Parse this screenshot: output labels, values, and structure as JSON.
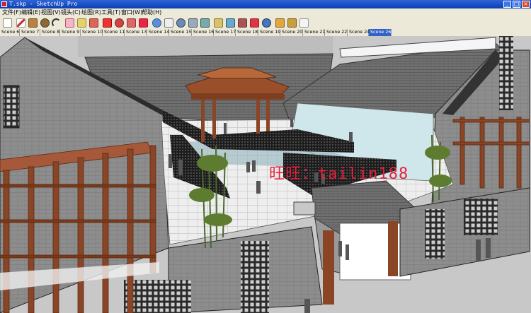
{
  "window": {
    "title": "T.skp - SketchUp Pro",
    "controls": [
      "minimize",
      "maximize",
      "close"
    ]
  },
  "menu": [
    "文件(F)",
    "编辑(E)",
    "视图(V)",
    "镜头(C)",
    "绘图(R)",
    "工具(T)",
    "窗口(W)",
    "帮助(H)"
  ],
  "toolbar": {
    "tools": [
      "select-icon",
      "pencil-icon",
      "rectangle-icon",
      "circle-icon",
      "arc-icon",
      "eraser-icon",
      "tape-measure-icon",
      "paint-bucket-icon",
      "push-pull-icon",
      "rotate-icon",
      "follow-me-icon",
      "offset-icon",
      "orbit-icon",
      "pan-icon",
      "zoom-icon",
      "zoom-window-icon",
      "zoom-extents-icon",
      "section-plane-icon",
      "walk-icon",
      "look-around-icon",
      "get-models-icon",
      "share-model-icon",
      "components-icon",
      "styles-icon"
    ]
  },
  "scenes": {
    "tabs": [
      "Scene 6",
      "Scene 7",
      "Scene 8",
      "Scene 9",
      "Scene 10",
      "Scene 11",
      "Scene 13",
      "Scene 14",
      "Scene 15",
      "Scene 16",
      "Scene 17",
      "Scene 18",
      "Scene 19",
      "Scene 20",
      "Scene 21",
      "Scene 22",
      "Scene 24",
      "Scene 26"
    ],
    "active": "Scene 26"
  },
  "viewport": {
    "watermark": "旺旺：tailin188",
    "colors": {
      "roof": "#6f6f6f",
      "wall": "#8e8e8e",
      "timber": "#8a4a2a",
      "floor": "#ececec",
      "pool": "#cfe8ec",
      "watermark": "#e8203a"
    }
  }
}
